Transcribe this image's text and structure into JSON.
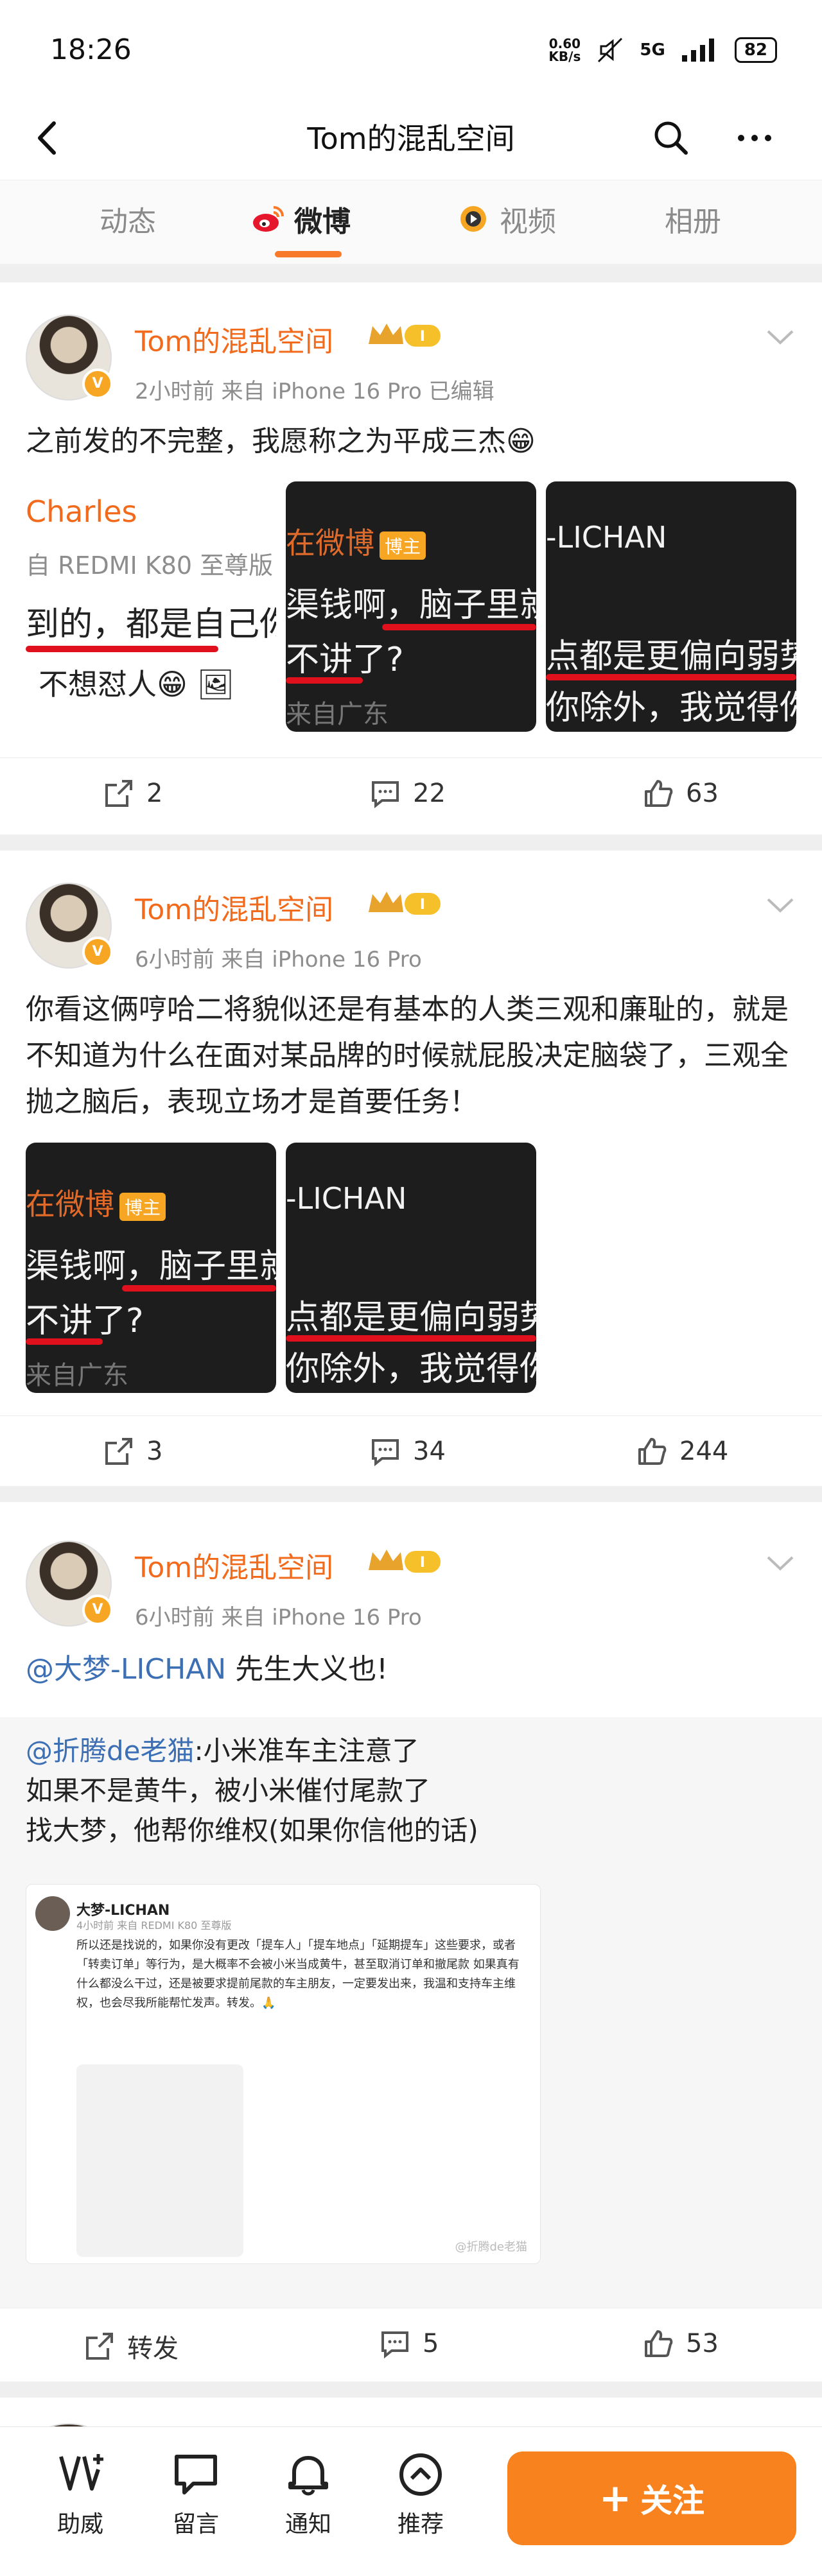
{
  "status_bar": {
    "time": "18:26",
    "net_speed_value": "0.60",
    "net_speed_unit": "KB/s",
    "network": "5G",
    "battery": "82"
  },
  "nav": {
    "title": "Tom的混乱空间"
  },
  "tabs": [
    {
      "label": "动态"
    },
    {
      "label": "微博"
    },
    {
      "label": "视频"
    },
    {
      "label": "相册"
    }
  ],
  "posts": [
    {
      "author": "Tom的混乱空间",
      "vip_level": "I",
      "meta": "2小时前   来自 iPhone 16 Pro   已编辑",
      "text": "之前发的不完整，我愿称之为平成三杰😁",
      "images": [
        {
          "lines": [
            "Charles",
            "自 REDMI K80 至尊版",
            "到的，都是自己你",
            "不想怼人😁 🖼"
          ]
        },
        {
          "lines": [
            "在微博",
            "渠钱啊，脑子里就",
            "不讲了?",
            "来自广东"
          ],
          "badge": "博主"
        },
        {
          "lines": [
            "-LICHAN",
            "",
            "点都是更偏向弱势",
            "你除外，我觉得你"
          ]
        }
      ],
      "repost_count": "2",
      "comment_count": "22",
      "like_count": "63"
    },
    {
      "author": "Tom的混乱空间",
      "vip_level": "I",
      "meta": "6小时前   来自 iPhone 16 Pro",
      "text": "你看这俩哼哈二将貌似还是有基本的人类三观和廉耻的，就是不知道为什么在面对某品牌的时候就屁股决定脑袋了，三观全抛之脑后，表现立场才是首要任务！",
      "images": [
        {
          "lines": [
            "在微博",
            "渠钱啊，脑子里就",
            "不讲了?",
            "来自广东"
          ],
          "badge": "博主"
        },
        {
          "lines": [
            "-LICHAN",
            "",
            "点都是更偏向弱势",
            "你除外，我觉得你"
          ]
        }
      ],
      "repost_count": "3",
      "comment_count": "34",
      "like_count": "244"
    },
    {
      "author": "Tom的混乱空间",
      "vip_level": "I",
      "meta": "6小时前   来自 iPhone 16 Pro",
      "mention": "@大梦-LICHAN",
      "text_after_mention": " 先生大义也!",
      "repost": {
        "mention": "@折腾de老猫",
        "line1": ":小米准车主注意了",
        "line2": "如果不是黄牛，被小米催付尾款了",
        "line3": "找大梦，他帮你维权(如果你信他的话)",
        "shot": {
          "name": "大梦-LICHAN",
          "meta": "4小时前  来自 REDMI K80 至尊版",
          "body": "所以还是找说的，如果你没有更改「提车人」「提车地点」「延期提车」这些要求，或者「转卖订单」等行为，是大概率不会被小米当成黄牛，甚至取消订单和撤尾款 如果真有什么都没么干过，还是被要求提前尾款的车主朋友，一定要发出来，我温和支持车主维权，也会尽我所能帮忙发声。转发。🙏",
          "watermark": "@折腾de老猫"
        }
      },
      "repost_label": "转发",
      "comment_count": "5",
      "like_count": "53"
    }
  ],
  "bottom_bar": {
    "items": [
      {
        "label": "助威"
      },
      {
        "label": "留言"
      },
      {
        "label": "通知"
      },
      {
        "label": "推荐"
      }
    ],
    "follow_label": "关注"
  },
  "colors": {
    "accent": "#f8792a",
    "username": "#f26a1b",
    "mention": "#3d6fb4"
  }
}
